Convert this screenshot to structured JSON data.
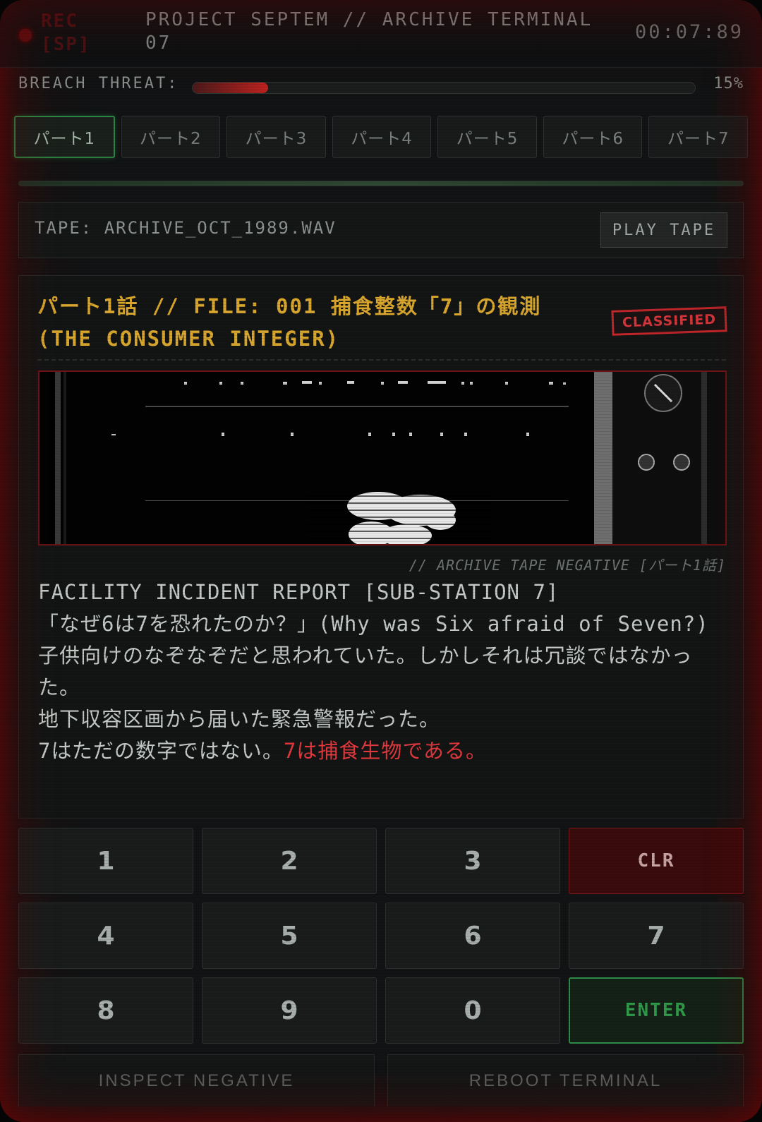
{
  "header": {
    "rec_label": "REC",
    "speed_label": "[SP]",
    "title": "PROJECT SEPTEM // ARCHIVE TERMINAL 07",
    "timer": "00:07:89"
  },
  "threat": {
    "label": "BREACH THREAT:",
    "percent_text": "15%",
    "level": 0.15
  },
  "tabs": [
    {
      "label": "パート1",
      "active": true
    },
    {
      "label": "パート2",
      "active": false
    },
    {
      "label": "パート3",
      "active": false
    },
    {
      "label": "パート4",
      "active": false
    },
    {
      "label": "パート5",
      "active": false
    },
    {
      "label": "パート6",
      "active": false
    },
    {
      "label": "パート7",
      "active": false
    }
  ],
  "tape": {
    "label": "TAPE: ARCHIVE_OCT_1989.WAV",
    "play_button": "PLAY TAPE"
  },
  "file": {
    "title": "パート1話 // FILE: 001 捕食整数「7」の観測 (THE CONSUMER INTEGER)",
    "stamp": "CLASSIFIED",
    "caption": "// ARCHIVE TAPE NEGATIVE [パート1話]",
    "report_lines": [
      "FACILITY INCIDENT REPORT [SUB-STATION 7]",
      "「なぜ6は7を恐れたのか？」(Why was Six afraid of Seven?)",
      "子供向けのなぞなぞだと思われていた。しかしそれは冗談ではなかった。",
      "地下収容区画から届いた緊急警報だった。"
    ],
    "final_line_plain": "7はただの数字ではない。",
    "final_line_alert": "7は捕食生物である。"
  },
  "keypad": {
    "keys": [
      "1",
      "2",
      "3",
      "CLR",
      "4",
      "5",
      "6",
      "7",
      "8",
      "9",
      "0",
      "ENTER"
    ]
  },
  "actions": {
    "inspect": "INSPECT NEGATIVE",
    "reboot": "REBOOT TERMINAL"
  },
  "colors": {
    "accent_green": "#2d8744",
    "alert_red": "#e0383c",
    "title_amber": "#d9a62e"
  }
}
